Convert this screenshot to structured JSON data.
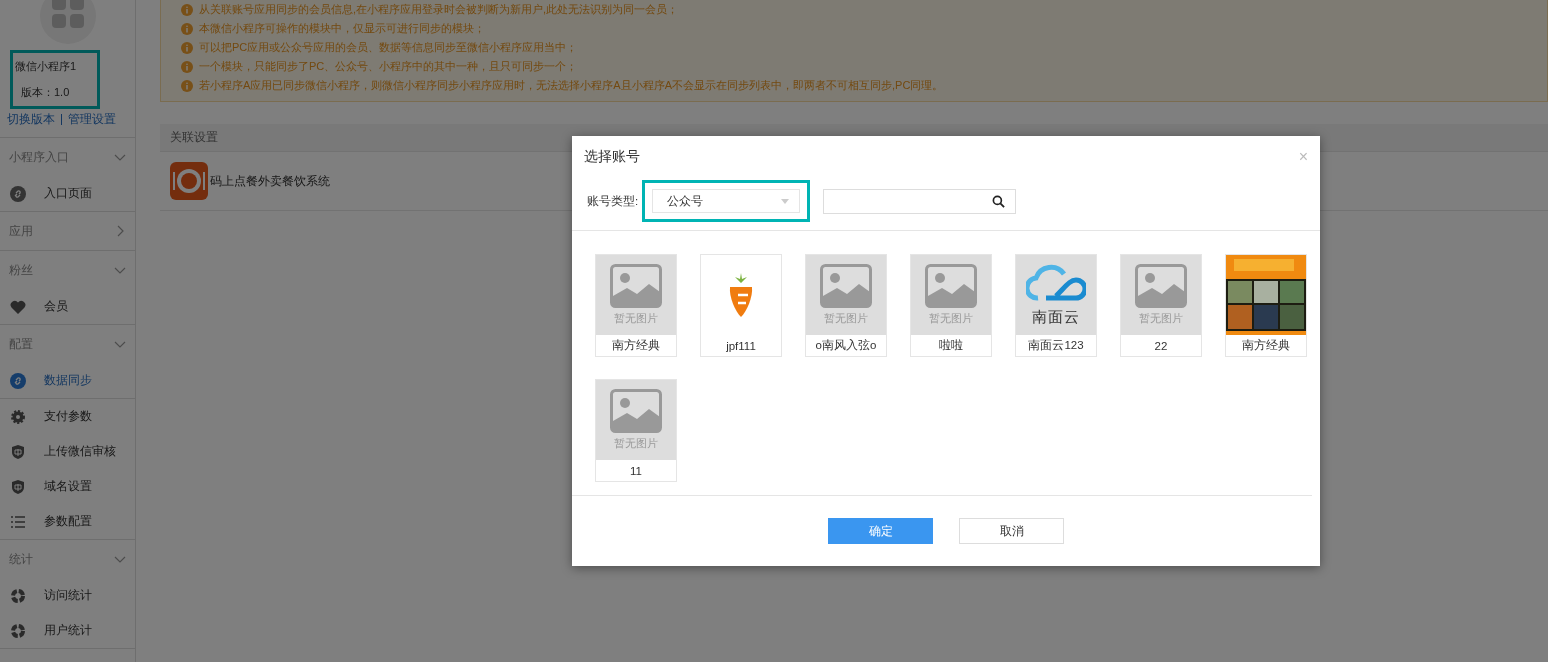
{
  "sidebar": {
    "app_name": "微信小程序1",
    "version": "版本：1.0",
    "links": [
      "切换版本",
      "管理设置"
    ],
    "sections": [
      {
        "label": "小程序入口",
        "expanded": true,
        "items": [
          {
            "label": "入口页面",
            "selected": false
          }
        ]
      },
      {
        "label": "应用",
        "expanded": false
      },
      {
        "label": "粉丝",
        "expanded": true,
        "items": [
          {
            "label": "会员",
            "selected": false
          }
        ]
      },
      {
        "label": "配置",
        "expanded": true,
        "items": [
          {
            "label": "数据同步",
            "selected": true
          },
          {
            "label": "支付参数",
            "selected": false
          },
          {
            "label": "上传微信审核",
            "selected": false
          },
          {
            "label": "域名设置",
            "selected": false
          },
          {
            "label": "参数配置",
            "selected": false
          }
        ]
      },
      {
        "label": "统计",
        "expanded": true,
        "items": [
          {
            "label": "访问统计",
            "selected": false
          },
          {
            "label": "用户统计",
            "selected": false
          }
        ]
      }
    ]
  },
  "notices": [
    "从关联账号应用同步的会员信息,在小程序应用登录时会被判断为新用户,此处无法识别为同一会员；",
    "本微信小程序可操作的模块中，仅显示可进行同步的模块；",
    "可以把PC应用或公众号应用的会员、数据等信息同步至微信小程序应用当中；",
    "一个模块，只能同步了PC、公众号、小程序中的其中一种，且只可同步一个；",
    "若小程序A应用已同步微信小程序，则微信小程序同步小程序应用时，无法选择小程序A且小程序A不会显示在同步列表中，即两者不可相互同步,PC同理。"
  ],
  "table": {
    "columns": [
      "关联设置"
    ],
    "rows": [
      {
        "name": "码上点餐外卖餐饮系统"
      }
    ]
  },
  "dialog": {
    "title": "选择账号",
    "close": "×",
    "type_label": "账号类型:",
    "type_value": "公众号",
    "accounts": [
      {
        "name": "南方经典",
        "kind": "placeholder",
        "placeholder_text": "暂无图片"
      },
      {
        "name": "jpf111",
        "kind": "carrot"
      },
      {
        "name": "o南风入弦o",
        "kind": "placeholder",
        "placeholder_text": "暂无图片"
      },
      {
        "name": "啦啦",
        "kind": "placeholder",
        "placeholder_text": "暂无图片"
      },
      {
        "name": "南面云123",
        "kind": "cloud",
        "logo_text": "南面云"
      },
      {
        "name": "22",
        "kind": "placeholder",
        "placeholder_text": "暂无图片"
      },
      {
        "name": "南方经典",
        "kind": "picture"
      },
      {
        "name": "11",
        "kind": "placeholder",
        "placeholder_text": "暂无图片"
      }
    ],
    "buttons": [
      "确定",
      "取消"
    ]
  }
}
